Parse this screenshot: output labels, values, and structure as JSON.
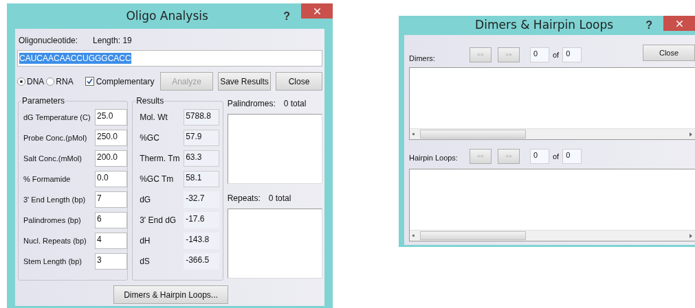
{
  "oligo_window": {
    "title": "Oligo Analysis",
    "help": "?",
    "oligo_label": "Oligonucleotide:",
    "length": "Length: 19",
    "sequence": "CAUCAACAACCUGGGCACC",
    "types": [
      {
        "label": "DNA",
        "selected": true
      },
      {
        "label": "RNA",
        "selected": false
      }
    ],
    "complementary": {
      "label": "Complementary",
      "checked": true
    },
    "buttons": [
      {
        "label": "Analyze",
        "disabled": true
      },
      {
        "label": "Save Results",
        "disabled": false
      },
      {
        "label": "Close",
        "disabled": false
      }
    ],
    "parameters": {
      "title": "Parameters",
      "rows": [
        {
          "label": "dG Temperature (C)",
          "value": "25.0"
        },
        {
          "label": "Probe Conc.(pMol)",
          "value": "250.0"
        },
        {
          "label": "Salt Conc.(mMol)",
          "value": "200.0"
        },
        {
          "label": "% Formamide",
          "value": "0.0"
        },
        {
          "label": "3' End Length (bp)",
          "value": "7"
        },
        {
          "label": "Palindromes (bp)",
          "value": "6"
        },
        {
          "label": "Nucl. Repeats (bp)",
          "value": "4"
        },
        {
          "label": "Stem Length (bp)",
          "value": "3"
        }
      ]
    },
    "results": {
      "title": "Results",
      "rows": [
        {
          "label": "Mol. Wt",
          "value": "5788.8",
          "bordered": true
        },
        {
          "label": "%GC",
          "value": "57.9",
          "bordered": true
        },
        {
          "label": "Therm. Tm",
          "value": "63.3",
          "bordered": true
        },
        {
          "label": "%GC Tm",
          "value": "58.1",
          "bordered": true
        },
        {
          "label": "dG",
          "value": "-32.7",
          "bordered": false
        },
        {
          "label": "3' End dG",
          "value": "-17.6",
          "bordered": false
        },
        {
          "label": "dH",
          "value": "-143.8",
          "bordered": false
        },
        {
          "label": "dS",
          "value": "-366.5",
          "bordered": false
        }
      ]
    },
    "palindromes": {
      "label": "Palindromes:",
      "total": "0 total"
    },
    "repeats": {
      "label": "Repeats:",
      "total": "0 total"
    },
    "dimers_button": "Dimers & Hairpin Loops..."
  },
  "dimers_window": {
    "title": "Dimers & Hairpin Loops",
    "help": "?",
    "close": "Close",
    "sections": [
      {
        "label": "Dimers:",
        "prev": "<<",
        "next": ">>",
        "current": "0",
        "of": "of",
        "total": "0"
      },
      {
        "label": "Hairpin Loops:",
        "prev": "<<",
        "next": ">>",
        "current": "0",
        "of": "of",
        "total": "0"
      }
    ]
  }
}
